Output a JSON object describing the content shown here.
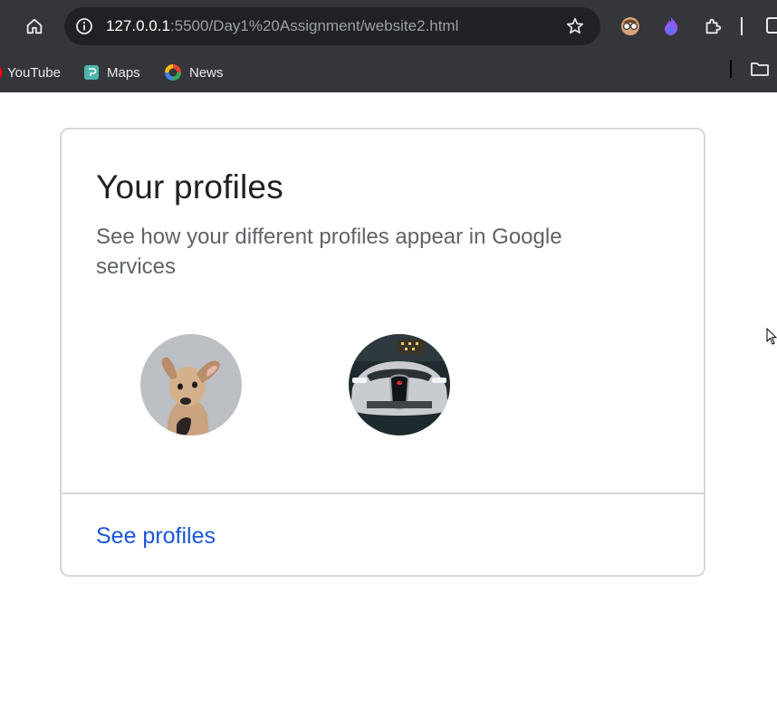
{
  "browser": {
    "url_host": "127.0.0.1",
    "url_path": ":5500/Day1%20Assignment/website2.html",
    "toolbar_icons": [
      "home-icon",
      "site-info-icon",
      "bookmark-star-icon",
      "extension-avatar-icon",
      "extension-flame-icon",
      "extensions-puzzle-icon"
    ],
    "bookmarks": [
      {
        "label": "YouTube",
        "icon": "youtube-icon"
      },
      {
        "label": "Maps",
        "icon": "maps-icon"
      },
      {
        "label": "News",
        "icon": "news-icon"
      }
    ],
    "other_bookmarks_icon": "folder-icon"
  },
  "card": {
    "title": "Your profiles",
    "subtitle": "See how your different profiles appear in Google services",
    "profiles": [
      {
        "avatar": "dog-photo"
      },
      {
        "avatar": "car-photo"
      }
    ],
    "link_label": "See profiles"
  },
  "colors": {
    "chrome_bg": "#35363a",
    "omnibox_bg": "#202124",
    "link": "#1a56db",
    "card_border": "#d5d7da"
  }
}
